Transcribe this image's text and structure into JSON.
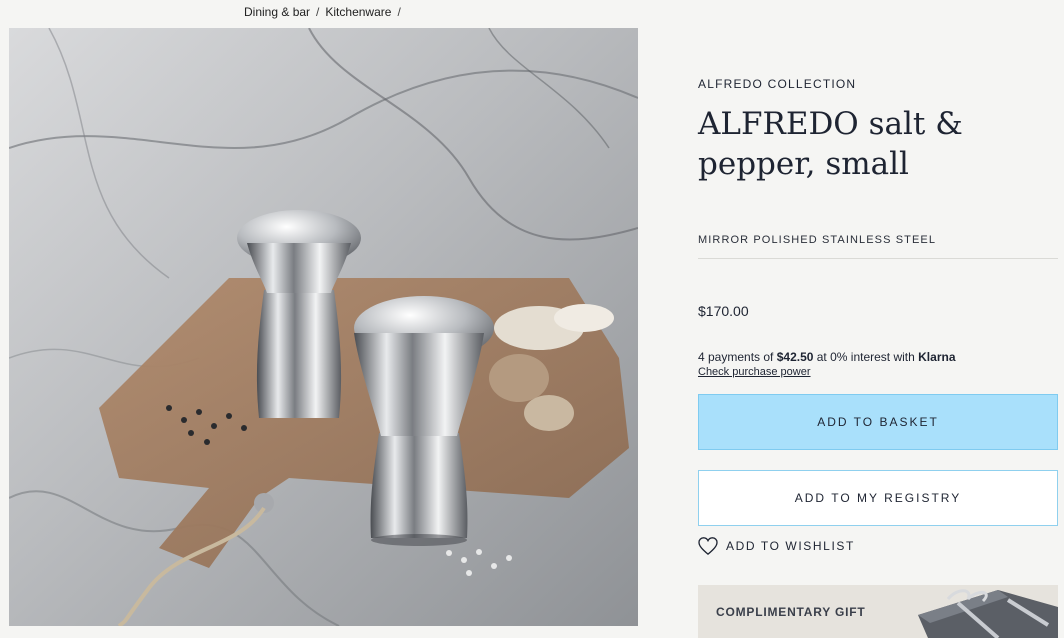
{
  "breadcrumb": {
    "items": [
      "Dining & bar",
      "Kitchenware"
    ],
    "separator": "/"
  },
  "product": {
    "collection": "ALFREDO COLLECTION",
    "title": "ALFREDO salt & pepper, small",
    "material": "MIRROR POLISHED STAINLESS STEEL",
    "price": "$170.00"
  },
  "klarna": {
    "prefix": "4 payments of ",
    "amount": "$42.50",
    "middle": " at 0% interest with ",
    "brand": "Klarna",
    "link": "Check purchase power"
  },
  "actions": {
    "add_to_basket": "ADD TO BASKET",
    "add_to_registry": "ADD TO MY REGISTRY",
    "wishlist": "ADD TO WISHLIST",
    "wishlist_icon": "heart-icon"
  },
  "gift": {
    "label": "COMPLIMENTARY GIFT"
  },
  "colors": {
    "accent": "#a9e0fb",
    "accent_border": "#8fd0ee",
    "text": "#1e2432",
    "gift_bg": "#e6e3dd"
  }
}
